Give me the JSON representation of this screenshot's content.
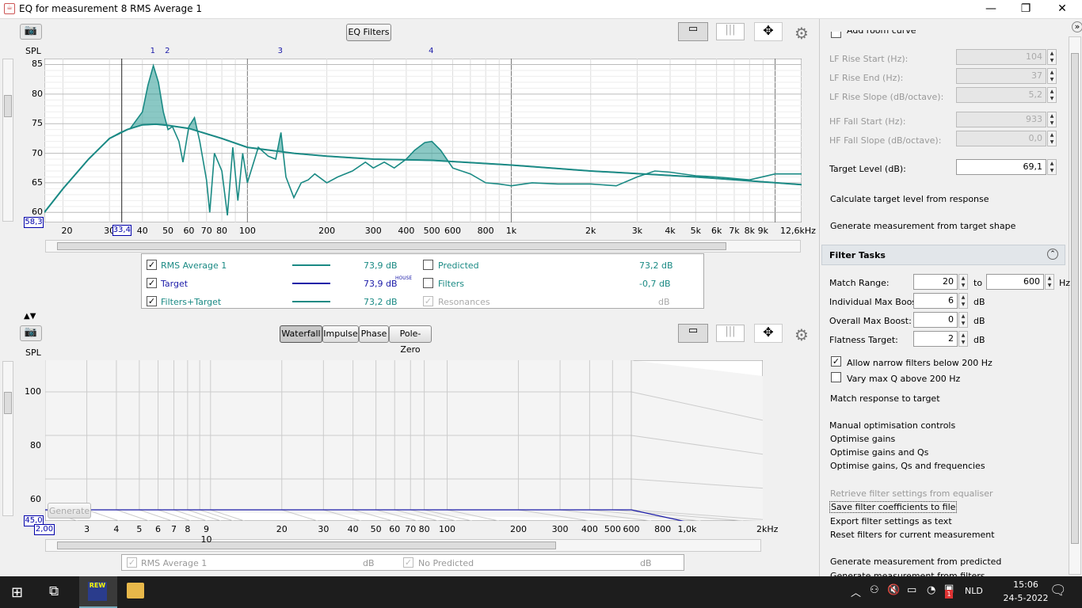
{
  "window": {
    "title": "EQ for measurement 8 RMS Average 1",
    "min": "—",
    "max": "❐",
    "close": "✕"
  },
  "top": {
    "eq_filters_btn": "EQ Filters",
    "y_label": "SPL",
    "y_ticks": [
      "85",
      "80",
      "75",
      "70",
      "65",
      "60"
    ],
    "y_value": "58,3",
    "x_ticks": [
      "20",
      "30",
      "33,4",
      "40",
      "50",
      "60",
      "70",
      "80",
      "100",
      "200",
      "300",
      "400",
      "500",
      "600",
      "800",
      "1k",
      "2k",
      "3k",
      "4k",
      "5k",
      "6k",
      "7k",
      "8k",
      "9k",
      "12,6kHz"
    ],
    "filter_markers": [
      "1",
      "2",
      "3",
      "4"
    ],
    "legend": {
      "rows": [
        {
          "name": "RMS Average 1",
          "value": "73,9 dB",
          "checked": true,
          "color": "#1a8a84"
        },
        {
          "name": "Target",
          "value": "73,9 dB",
          "sup": "HOUSE",
          "checked": true,
          "color": "#1a1aa8"
        },
        {
          "name": "Filters+Target",
          "value": "73,2 dB",
          "checked": true,
          "color": "#1a8a84"
        }
      ],
      "rows2": [
        {
          "name": "Predicted",
          "value": "73,2 dB",
          "checked": false
        },
        {
          "name": "Filters",
          "value": "-0,7 dB",
          "checked": false
        },
        {
          "name": "Resonances",
          "value": "dB",
          "checked": true,
          "disabled": true
        }
      ]
    }
  },
  "bottom": {
    "tabs": [
      "Waterfall",
      "Impulse",
      "Phase",
      "Pole-Zero"
    ],
    "active_tab": "Waterfall",
    "y_label": "SPL",
    "y_ticks": [
      "100",
      "80",
      "60"
    ],
    "y_value": "45,0",
    "x_value": "2,00",
    "x_ticks": [
      "3",
      "4",
      "5",
      "6",
      "7",
      "8",
      "9 10",
      "20",
      "30",
      "40",
      "50",
      "60",
      "70",
      "80",
      "100",
      "200",
      "300",
      "400",
      "500",
      "600",
      "800",
      "1,0k",
      "2kHz"
    ],
    "generate_btn": "Generate",
    "legend": {
      "rows": [
        {
          "name": "RMS Average 1",
          "value": "dB"
        },
        {
          "name": "No Predicted",
          "value": "dB"
        }
      ]
    }
  },
  "right": {
    "add_room_curve": "Add room curve",
    "fields": [
      {
        "label": "LF Rise Start (Hz):",
        "value": "104",
        "disabled": true
      },
      {
        "label": "LF Rise End (Hz):",
        "value": "37",
        "disabled": true
      },
      {
        "label": "LF Rise Slope (dB/octave):",
        "value": "5,2",
        "disabled": true
      },
      {
        "label": "HF Fall Start (Hz):",
        "value": "933",
        "disabled": true
      },
      {
        "label": "HF Fall Slope (dB/octave):",
        "value": "0,0",
        "disabled": true
      },
      {
        "label": "Target Level (dB):",
        "value": "69,1",
        "disabled": false
      }
    ],
    "calc_target": "Calculate target level from response",
    "gen_meas": "Generate measurement from target shape",
    "filter_tasks": {
      "title": "Filter Tasks",
      "match_range_label": "Match Range:",
      "match_from": "20",
      "to": "to",
      "match_to": "600",
      "hz": "Hz",
      "ind_boost_label": "Individual Max Boost:",
      "ind_boost": "6",
      "db1": "dB",
      "ovr_boost_label": "Overall Max Boost:",
      "ovr_boost": "0",
      "db2": "dB",
      "flat_label": "Flatness Target:",
      "flat": "2",
      "db3": "dB",
      "allow_narrow": "Allow narrow filters below 200 Hz",
      "vary_q": "Vary max Q above 200 Hz",
      "match_resp": "Match response to target",
      "manual": "Manual optimisation controls",
      "opt_gains": "Optimise gains",
      "opt_gq": "Optimise gains and Qs",
      "opt_gqf": "Optimise gains, Qs and frequencies",
      "retrieve": "Retrieve filter settings from equaliser",
      "save_coeff": "Save filter coefficients to file",
      "export": "Export filter settings as text",
      "reset": "Reset filters for current measurement",
      "gen_pred": "Generate measurement from predicted",
      "gen_filters": "Generate measurement from filters"
    }
  },
  "taskbar": {
    "app": "REW",
    "lang": "NLD",
    "time": "15:06",
    "date": "24-5-2022",
    "badge": "1"
  },
  "chart_data": {
    "type": "line",
    "title": "",
    "xlabel": "",
    "ylabel": "SPL",
    "xscale": "log",
    "xlim": [
      17,
      12600
    ],
    "ylim": [
      58.3,
      86
    ],
    "filter_frequencies": [
      44,
      50,
      134,
      500
    ],
    "series": [
      {
        "name": "RMS Average 1",
        "x": [
          17,
          20,
          25,
          30,
          33,
          36,
          40,
          42,
          44,
          46,
          48,
          50,
          52,
          55,
          57,
          60,
          63,
          66,
          70,
          72,
          75,
          80,
          84,
          88,
          92,
          96,
          100,
          110,
          120,
          128,
          134,
          140,
          150,
          160,
          170,
          180,
          200,
          220,
          250,
          280,
          300,
          330,
          360,
          400,
          430,
          470,
          500,
          540,
          600,
          700,
          800,
          900,
          1000,
          1200,
          1500,
          2000,
          2500,
          3000,
          3500,
          4000,
          5000,
          6000,
          8000,
          10000,
          12600
        ],
        "y": [
          60,
          64,
          69,
          72.5,
          73.5,
          74.2,
          77,
          81.5,
          84.8,
          82,
          77,
          74,
          74.5,
          72,
          68.5,
          74.5,
          76,
          72,
          65.5,
          60,
          70,
          67,
          59.5,
          71,
          62,
          70,
          65,
          71,
          69.5,
          69,
          73.5,
          66,
          62.5,
          65,
          65.5,
          66.5,
          65,
          66,
          67,
          68.5,
          67.5,
          68.5,
          67.5,
          69,
          70.5,
          71.8,
          72,
          70.5,
          67.5,
          66.5,
          65,
          64.8,
          64.5,
          65,
          64.8,
          64.8,
          64.5,
          66,
          67,
          66.8,
          66.2,
          66,
          65.5,
          66.5,
          66.5
        ]
      },
      {
        "name": "Target",
        "x": [
          17,
          20,
          25,
          30,
          35,
          40,
          45,
          50,
          60,
          80,
          100,
          150,
          200,
          300,
          500,
          1000,
          2000,
          5000,
          12600
        ],
        "y": [
          60,
          64,
          69,
          72.5,
          74,
          74.8,
          74.9,
          74.7,
          74.2,
          72.5,
          71,
          70,
          69.5,
          69,
          68.8,
          68,
          67,
          66,
          64.7
        ]
      },
      {
        "name": "Filters+Target",
        "x": [
          17,
          20,
          25,
          30,
          35,
          40,
          45,
          50,
          60,
          80,
          100,
          150,
          200,
          300,
          500,
          1000,
          2000,
          5000,
          12600
        ],
        "y": [
          60,
          64,
          69,
          72.5,
          74,
          74.8,
          74.9,
          74.7,
          74.2,
          72.5,
          71,
          70,
          69.5,
          69,
          68.8,
          68,
          67,
          66,
          64.7
        ]
      }
    ]
  }
}
